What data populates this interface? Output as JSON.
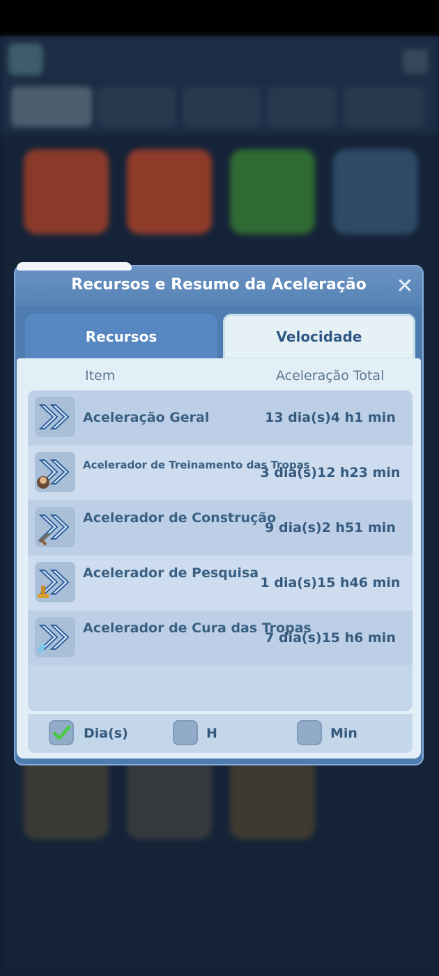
{
  "dialog": {
    "title": "Recursos e Resumo da Aceleração",
    "close_symbol": "✕",
    "tabs": [
      {
        "label": "Recursos",
        "active": false
      },
      {
        "label": "Velocidade",
        "active": true
      }
    ],
    "columns": {
      "item": "Item",
      "total": "Aceleração Total"
    },
    "rows": [
      {
        "icon": "speedup-general-icon",
        "name": "Aceleração Geral",
        "value": "13 dia(s)4 h1 min"
      },
      {
        "icon": "speedup-training-icon",
        "name": "Acelerador de Treinamento das Tropas",
        "value": "3 dia(s)12 h23 min"
      },
      {
        "icon": "speedup-construction-icon",
        "name": "Acelerador de Construção",
        "value": "9 dia(s)2 h51 min"
      },
      {
        "icon": "speedup-research-icon",
        "name": "Acelerador de Pesquisa",
        "value": "1 dia(s)15 h46 min"
      },
      {
        "icon": "speedup-healing-icon",
        "name": "Acelerador de Cura das Tropas",
        "value": "7 dia(s)15 h6 min"
      }
    ],
    "units": [
      {
        "label": "Dia(s)",
        "checked": true
      },
      {
        "label": "H",
        "checked": false
      },
      {
        "label": "Min",
        "checked": false
      }
    ],
    "accent_color": "#4f7cae",
    "check_color": "#4cc94c"
  }
}
